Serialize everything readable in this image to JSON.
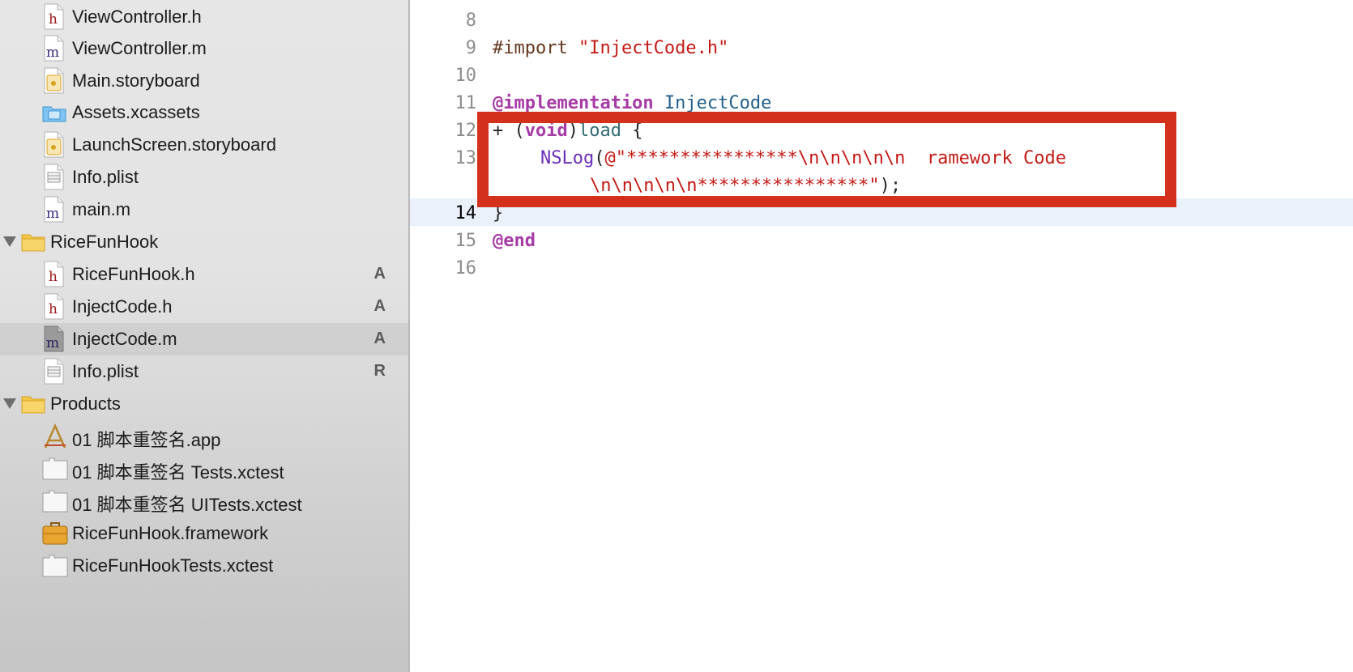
{
  "navigator": {
    "items": [
      {
        "label": "ViewController.h",
        "icon": "header-file-icon",
        "status": ""
      },
      {
        "label": "ViewController.m",
        "icon": "implementation-file-icon",
        "status": ""
      },
      {
        "label": "Main.storyboard",
        "icon": "storyboard-file-icon",
        "status": ""
      },
      {
        "label": "Assets.xcassets",
        "icon": "assets-catalog-icon",
        "status": ""
      },
      {
        "label": "LaunchScreen.storyboard",
        "icon": "storyboard-file-icon",
        "status": ""
      },
      {
        "label": "Info.plist",
        "icon": "plist-file-icon",
        "status": ""
      },
      {
        "label": "main.m",
        "icon": "implementation-file-icon",
        "status": ""
      },
      {
        "label": "RiceFunHook",
        "icon": "folder-icon",
        "status": ""
      },
      {
        "label": "RiceFunHook.h",
        "icon": "header-file-icon",
        "status": "A"
      },
      {
        "label": "InjectCode.h",
        "icon": "header-file-icon",
        "status": "A"
      },
      {
        "label": "InjectCode.m",
        "icon": "implementation-file-icon",
        "status": "A"
      },
      {
        "label": "Info.plist",
        "icon": "plist-file-icon",
        "status": "R"
      },
      {
        "label": "Products",
        "icon": "folder-icon",
        "status": ""
      },
      {
        "label": "01 脚本重签名.app",
        "icon": "app-icon",
        "status": ""
      },
      {
        "label": "01 脚本重签名 Tests.xctest",
        "icon": "xctest-bundle-icon",
        "status": ""
      },
      {
        "label": "01 脚本重签名 UITests.xctest",
        "icon": "xctest-bundle-icon",
        "status": ""
      },
      {
        "label": "RiceFunHook.framework",
        "icon": "framework-icon",
        "status": ""
      },
      {
        "label": "RiceFunHookTests.xctest",
        "icon": "xctest-bundle-icon",
        "status": ""
      }
    ]
  },
  "editor": {
    "line_numbers": [
      "8",
      "9",
      "10",
      "11",
      "12",
      "13",
      "",
      "14",
      "15",
      "16"
    ],
    "code": {
      "l9_import": "#import",
      "l9_string": "\"InjectCode.h\"",
      "l11_kw": "@implementation",
      "l11_class": "InjectCode",
      "l12_plus": "+ (",
      "l12_void": "void",
      "l12_close": ")",
      "l12_method": "load",
      "l12_brace": " {",
      "l13_fn": "NSLog",
      "l13_paren": "(",
      "l13_string": "@\"****************\\n\\n\\n\\n\\n  ramework Code",
      "l13b_string": "\\n\\n\\n\\n\\n****************\"",
      "l13b_end": ");",
      "l14_brace": "}",
      "l15_end": "@end"
    }
  },
  "colors": {
    "highlight_border": "#d4311d",
    "keyword": "#a63ba6",
    "string": "#c41a16",
    "class_name": "#235f8a"
  }
}
